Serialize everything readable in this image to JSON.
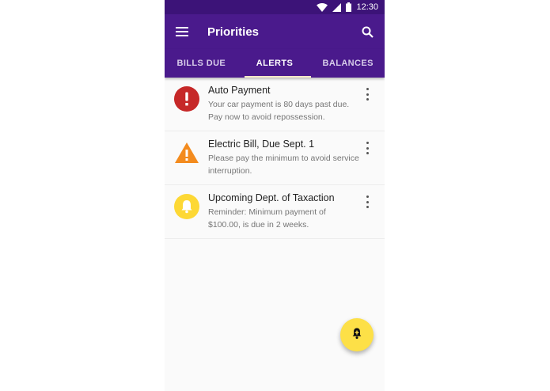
{
  "status_bar": {
    "time": "12:30",
    "wifi_icon": "wifi-icon",
    "signal_icon": "signal-icon",
    "battery_icon": "battery-icon"
  },
  "app_bar": {
    "title": "Priorities",
    "menu_icon": "menu-icon",
    "search_icon": "search-icon",
    "color": "#4a1a8c"
  },
  "tabs": [
    {
      "label": "BILLS DUE",
      "active": false
    },
    {
      "label": "ALERTS",
      "active": true
    },
    {
      "label": "BALANCES",
      "active": false
    }
  ],
  "alerts": [
    {
      "title": "Auto Payment",
      "body": "Your car payment is 80 days past due. Pay now to avoid repossession.",
      "icon": "error-icon",
      "icon_color": "#c62828"
    },
    {
      "title": "Electric Bill, Due Sept. 1",
      "body": "Please pay the minimum to avoid service interruption.",
      "icon": "warning-icon",
      "icon_color": "#f38b1e"
    },
    {
      "title": "Upcoming Dept. of Taxaction",
      "body": "Reminder: Minimum payment of $100.00, is due in 2 weeks.",
      "icon": "bell-icon",
      "icon_color": "#fdd835"
    }
  ],
  "fab": {
    "icon": "add-alert-icon",
    "color": "#fde047"
  }
}
